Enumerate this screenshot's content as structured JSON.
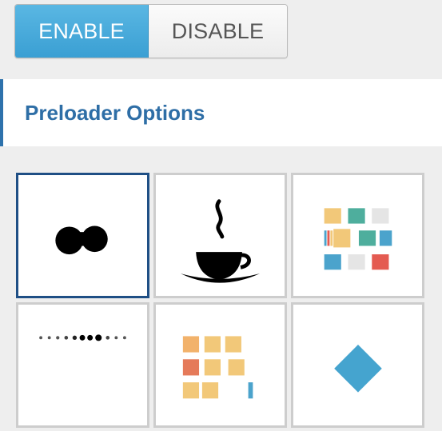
{
  "toggle": {
    "enable_label": "ENABLE",
    "disable_label": "DISABLE",
    "active": "enable"
  },
  "section": {
    "title": "Preloader Options"
  },
  "preloaders": [
    {
      "icon": "morphing-blob-icon",
      "selected": true
    },
    {
      "icon": "coffee-cup-icon",
      "selected": false
    },
    {
      "icon": "colored-squares-icon",
      "selected": false
    },
    {
      "icon": "dots-wave-icon",
      "selected": false
    },
    {
      "icon": "orange-squares-icon",
      "selected": false
    },
    {
      "icon": "blue-diamond-icon",
      "selected": false
    }
  ],
  "colors": {
    "accent": "#3a9fd3",
    "selected_border": "#1f4f85",
    "title": "#2e6ea6"
  }
}
